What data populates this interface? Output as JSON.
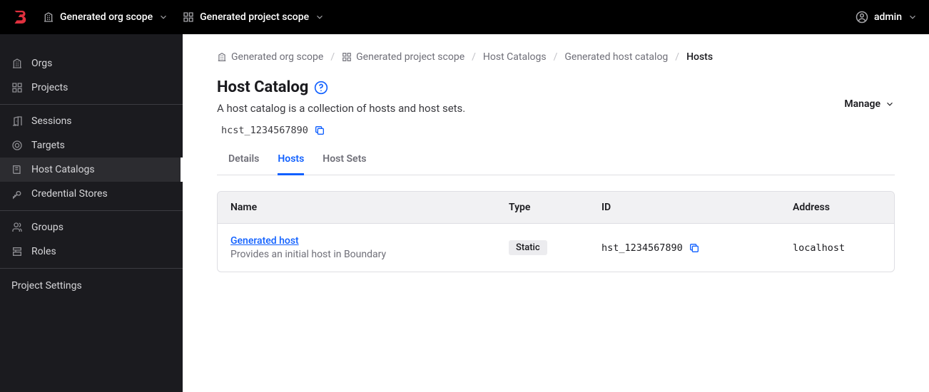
{
  "header": {
    "org_scope": "Generated org scope",
    "project_scope": "Generated project scope",
    "user": "admin"
  },
  "sidebar": {
    "groups": [
      {
        "items": [
          {
            "label": "Orgs",
            "icon": "org-icon"
          },
          {
            "label": "Projects",
            "icon": "grid-icon"
          }
        ]
      },
      {
        "items": [
          {
            "label": "Sessions",
            "icon": "door-icon"
          },
          {
            "label": "Targets",
            "icon": "target-icon"
          },
          {
            "label": "Host Catalogs",
            "icon": "catalog-icon",
            "active": true
          },
          {
            "label": "Credential Stores",
            "icon": "key-icon"
          }
        ]
      },
      {
        "items": [
          {
            "label": "Groups",
            "icon": "users-icon"
          },
          {
            "label": "Roles",
            "icon": "role-icon"
          }
        ]
      }
    ],
    "footer": "Project Settings"
  },
  "breadcrumb": [
    {
      "label": "Generated org scope",
      "icon": "org-icon"
    },
    {
      "label": "Generated project scope",
      "icon": "grid-icon"
    },
    {
      "label": "Host Catalogs"
    },
    {
      "label": "Generated host catalog"
    },
    {
      "label": "Hosts",
      "current": true
    }
  ],
  "page": {
    "title": "Host Catalog",
    "description": "A host catalog is a collection of hosts and host sets.",
    "manage_label": "Manage",
    "resource_id": "hcst_1234567890"
  },
  "tabs": [
    {
      "label": "Details"
    },
    {
      "label": "Hosts",
      "active": true
    },
    {
      "label": "Host Sets"
    }
  ],
  "table": {
    "columns": {
      "name": "Name",
      "type": "Type",
      "id": "ID",
      "address": "Address"
    },
    "rows": [
      {
        "name": "Generated host",
        "description": "Provides an initial host in Boundary",
        "type": "Static",
        "id": "hst_1234567890",
        "address": "localhost"
      }
    ]
  }
}
